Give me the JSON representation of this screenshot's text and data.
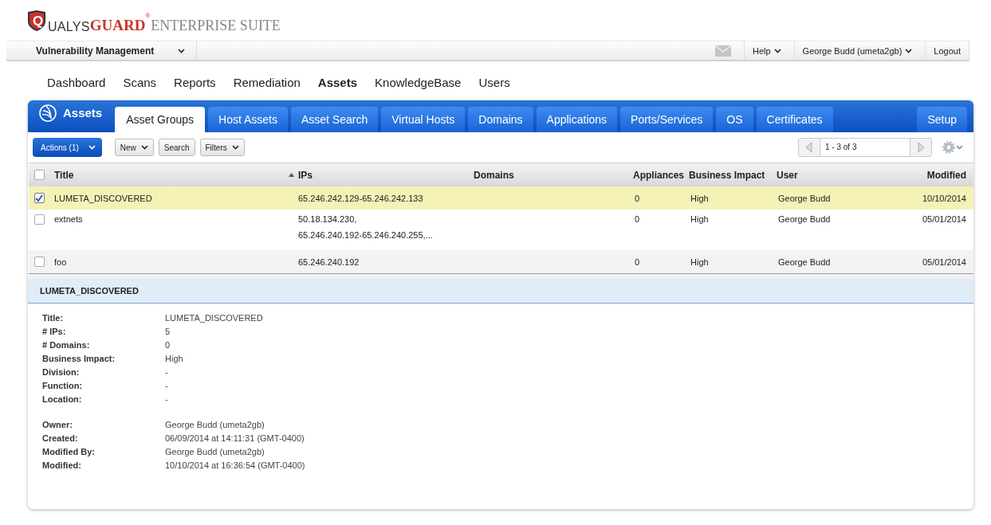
{
  "logo": {
    "initial": "Q",
    "brand": "UALYS",
    "product": "GUARD",
    "mark": "®",
    "suite": "ENTERPRISE SUITE"
  },
  "top_bar": {
    "module": "Vulnerability Management",
    "links": [
      {
        "label": "Help",
        "dropdown": true
      },
      {
        "label": "George Budd (umeta2gb)",
        "dropdown": true
      },
      {
        "label": "Logout",
        "dropdown": false
      }
    ]
  },
  "nav": [
    {
      "label": "Dashboard",
      "selected": false
    },
    {
      "label": "Scans",
      "selected": false
    },
    {
      "label": "Reports",
      "selected": false
    },
    {
      "label": "Remediation",
      "selected": false
    },
    {
      "label": "Assets",
      "selected": true
    },
    {
      "label": "KnowledgeBase",
      "selected": false
    },
    {
      "label": "Users",
      "selected": false
    }
  ],
  "panel": {
    "title": "Assets",
    "tabs": [
      {
        "label": "Asset Groups",
        "selected": true
      },
      {
        "label": "Host Assets",
        "selected": false
      },
      {
        "label": "Asset Search",
        "selected": false
      },
      {
        "label": "Virtual Hosts",
        "selected": false
      },
      {
        "label": "Domains",
        "selected": false
      },
      {
        "label": "Applications",
        "selected": false
      },
      {
        "label": "Ports/Services",
        "selected": false
      },
      {
        "label": "OS",
        "selected": false
      },
      {
        "label": "Certificates",
        "selected": false
      },
      {
        "label": "Setup",
        "selected": false
      }
    ]
  },
  "toolbar": {
    "actions": "Actions (1)",
    "buttons": [
      {
        "label": "New",
        "dropdown": true
      },
      {
        "label": "Search",
        "dropdown": false
      },
      {
        "label": "Filters",
        "dropdown": true
      }
    ],
    "pager": "1 - 3 of 3"
  },
  "table": {
    "all_checked": false,
    "columns": [
      {
        "label": "Title",
        "sorted": true
      },
      {
        "label": "IPs",
        "sorted": false
      },
      {
        "label": "Domains",
        "sorted": false
      },
      {
        "label": "Appliances",
        "sorted": false
      },
      {
        "label": "Business Impact",
        "sorted": false
      },
      {
        "label": "User",
        "sorted": false
      },
      {
        "label": "Modified",
        "sorted": false
      }
    ],
    "rows": [
      {
        "checked": true,
        "selected": true,
        "title": "LUMETA_DISCOVERED",
        "ips": [
          "65.246.242.129-65.246.242.133"
        ],
        "appliances": "0",
        "impact": "High",
        "user": "George Budd",
        "modified": "10/10/2014"
      },
      {
        "checked": false,
        "selected": false,
        "title": "extnets",
        "ips": [
          "50.18.134.230,",
          "65.246.240.192-65.246.240.255,..."
        ],
        "appliances": "0",
        "impact": "High",
        "user": "George Budd",
        "modified": "05/01/2014"
      },
      {
        "checked": false,
        "selected": false,
        "title": "foo",
        "ips": [
          "65.246.240.192"
        ],
        "appliances": "0",
        "impact": "High",
        "user": "George Budd",
        "modified": "05/01/2014"
      }
    ]
  },
  "details": {
    "heading": "LUMETA_DISCOVERED",
    "groups": [
      [
        {
          "label": "Title:",
          "value": "LUMETA_DISCOVERED"
        },
        {
          "label": "# IPs:",
          "value": "5"
        },
        {
          "label": "# Domains:",
          "value": "0"
        },
        {
          "label": "Business Impact:",
          "value": "High"
        },
        {
          "label": "Division:",
          "value": "-"
        },
        {
          "label": "Function:",
          "value": "-"
        },
        {
          "label": "Location:",
          "value": "-"
        }
      ],
      [
        {
          "label": "Owner:",
          "value": "George Budd (umeta2gb)"
        },
        {
          "label": "Created:",
          "value": "06/09/2014 at 14:11:31 (GMT-0400)"
        },
        {
          "label": "Modified By:",
          "value": "George Budd (umeta2gb)"
        },
        {
          "label": "Modified:",
          "value": "10/10/2014 at 16:36:54 (GMT-0400)"
        }
      ]
    ]
  }
}
